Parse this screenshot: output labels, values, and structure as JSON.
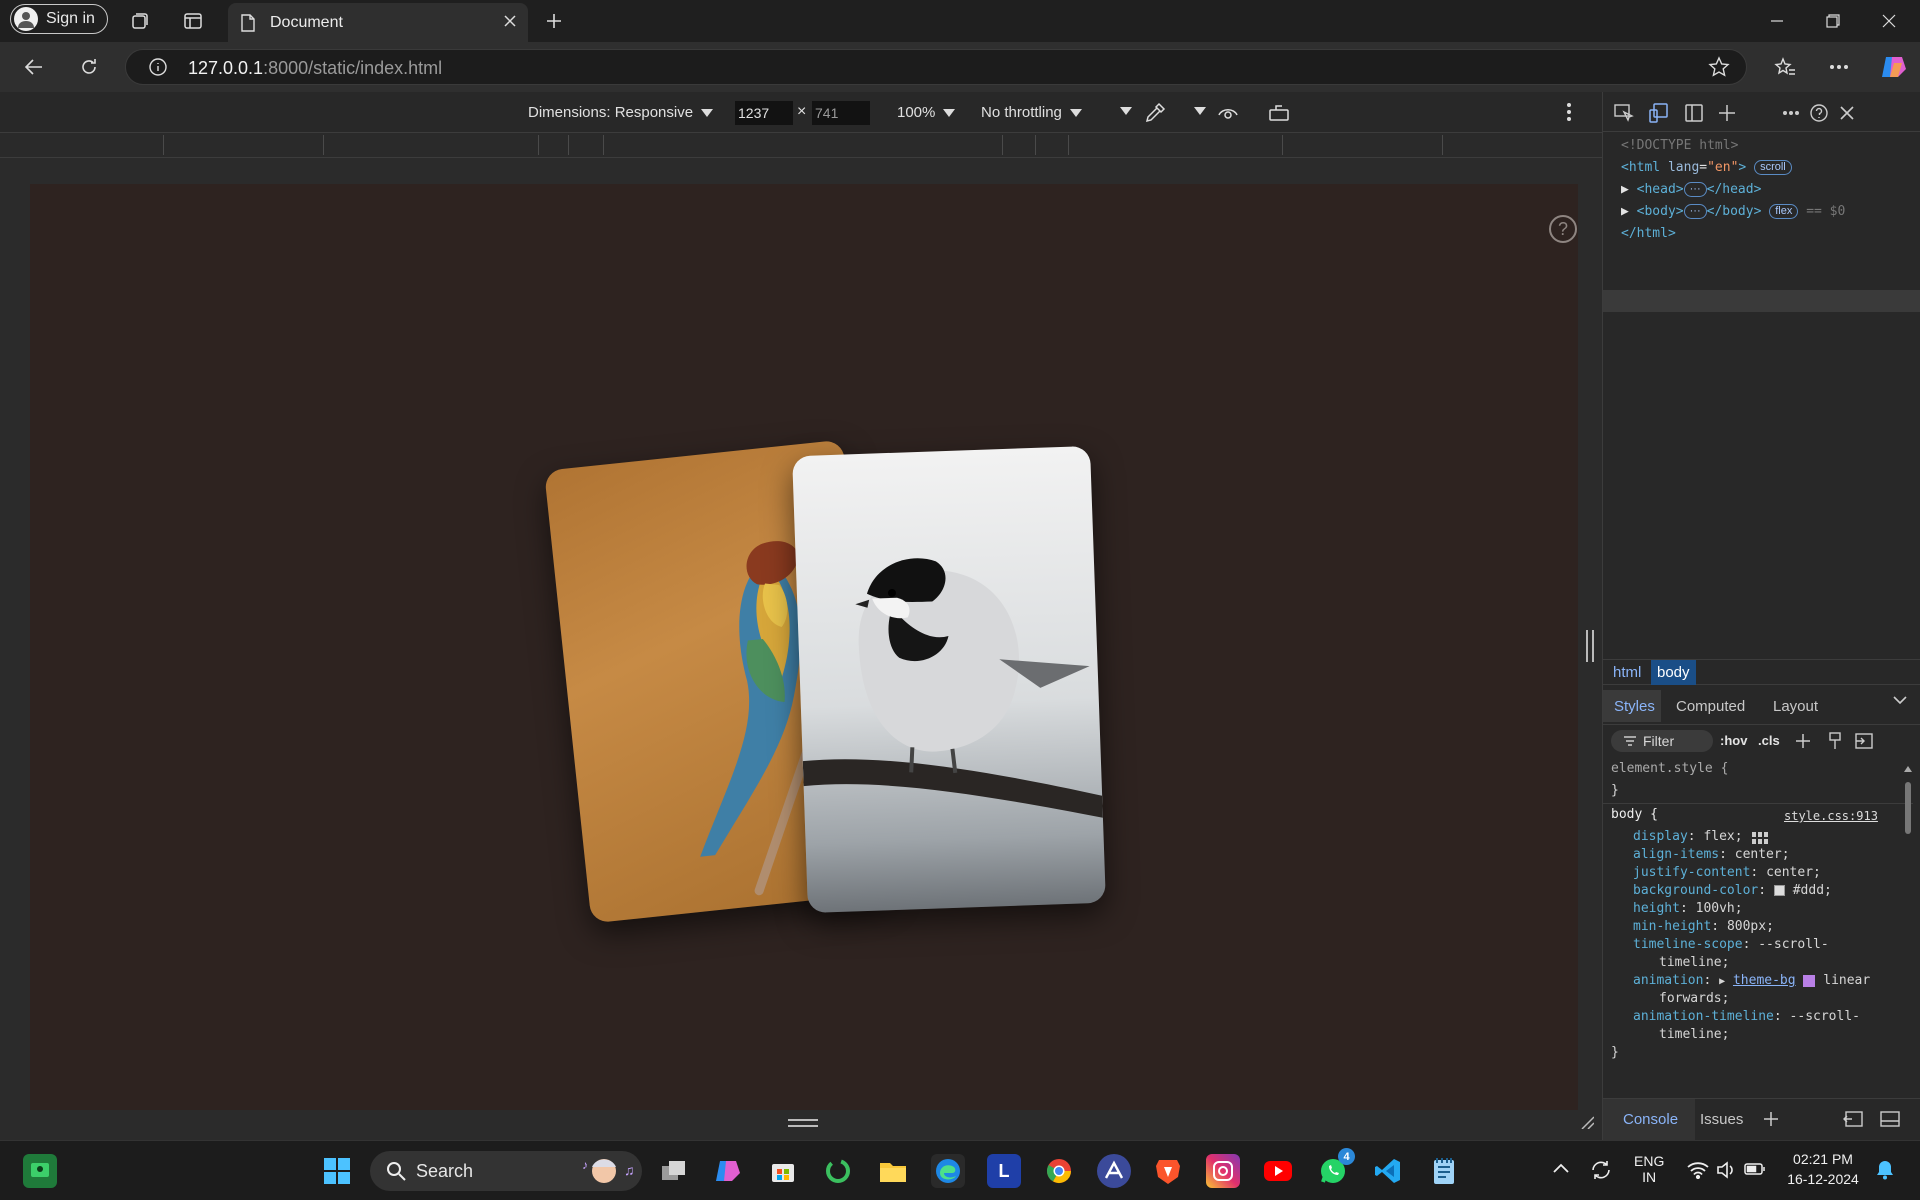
{
  "browser": {
    "signin_label": "Sign in",
    "tab_title": "Document",
    "url_host": "127.0.0.1",
    "url_rest": ":8000/static/index.html"
  },
  "device_toolbar": {
    "dimensions_label": "Dimensions: Responsive",
    "width": "1237",
    "height": "741",
    "times": "×",
    "zoom": "100%",
    "throttling": "No throttling"
  },
  "page": {
    "help_symbol": "?",
    "background": "#2e2320",
    "cards": [
      {
        "subject": "bee-eater bird on twig",
        "tone": "#c68a45"
      },
      {
        "subject": "chickadee bird on branch",
        "tone": "#e6e8ea"
      }
    ]
  },
  "devtools": {
    "dom": {
      "doctype": "<!DOCTYPE html>",
      "html_open_tag": "<html",
      "html_attr_name": "lang",
      "html_attr_val": "\"en\"",
      "html_open_close": ">",
      "scroll_badge": "scroll",
      "head_line": "<head>",
      "head_close": "</head>",
      "body_line": "<body>",
      "body_close": "</body>",
      "flex_badge": "flex",
      "dollar": "== $0",
      "html_close": "</html>",
      "ellipsis": "···"
    },
    "breadcrumbs": [
      "html",
      "body"
    ],
    "tabs": [
      "Styles",
      "Computed",
      "Layout"
    ],
    "filter_label": "Filter",
    "hov": ":hov",
    "cls": ".cls",
    "element_style": "element.style {",
    "close_brace": "}",
    "rule_selector": "body {",
    "rule_source": "style.css:913",
    "declarations": [
      {
        "prop": "display",
        "val": "flex;"
      },
      {
        "prop": "align-items",
        "val": "center;"
      },
      {
        "prop": "justify-content",
        "val": "center;"
      },
      {
        "prop": "background-color",
        "val": "#ddd;"
      },
      {
        "prop": "height",
        "val": "100vh;"
      },
      {
        "prop": "min-height",
        "val": "800px;"
      },
      {
        "prop": "timeline-scope",
        "val": "--scroll-"
      },
      {
        "prop": "",
        "val": "timeline;"
      },
      {
        "prop": "animation",
        "val": "theme-bg"
      },
      {
        "prop": "",
        "val": "forwards;"
      },
      {
        "prop": "animation-timeline",
        "val": "--scroll-"
      },
      {
        "prop": "",
        "val": "timeline;"
      }
    ],
    "animation_linear": "linear",
    "bottom_tabs": [
      "Console",
      "Issues"
    ]
  },
  "taskbar": {
    "search_label": "Search",
    "whatsapp_badge": "4",
    "lang_top": "ENG",
    "lang_bottom": "IN",
    "time": "02:21 PM",
    "date": "16-12-2024",
    "l_app": "L"
  }
}
